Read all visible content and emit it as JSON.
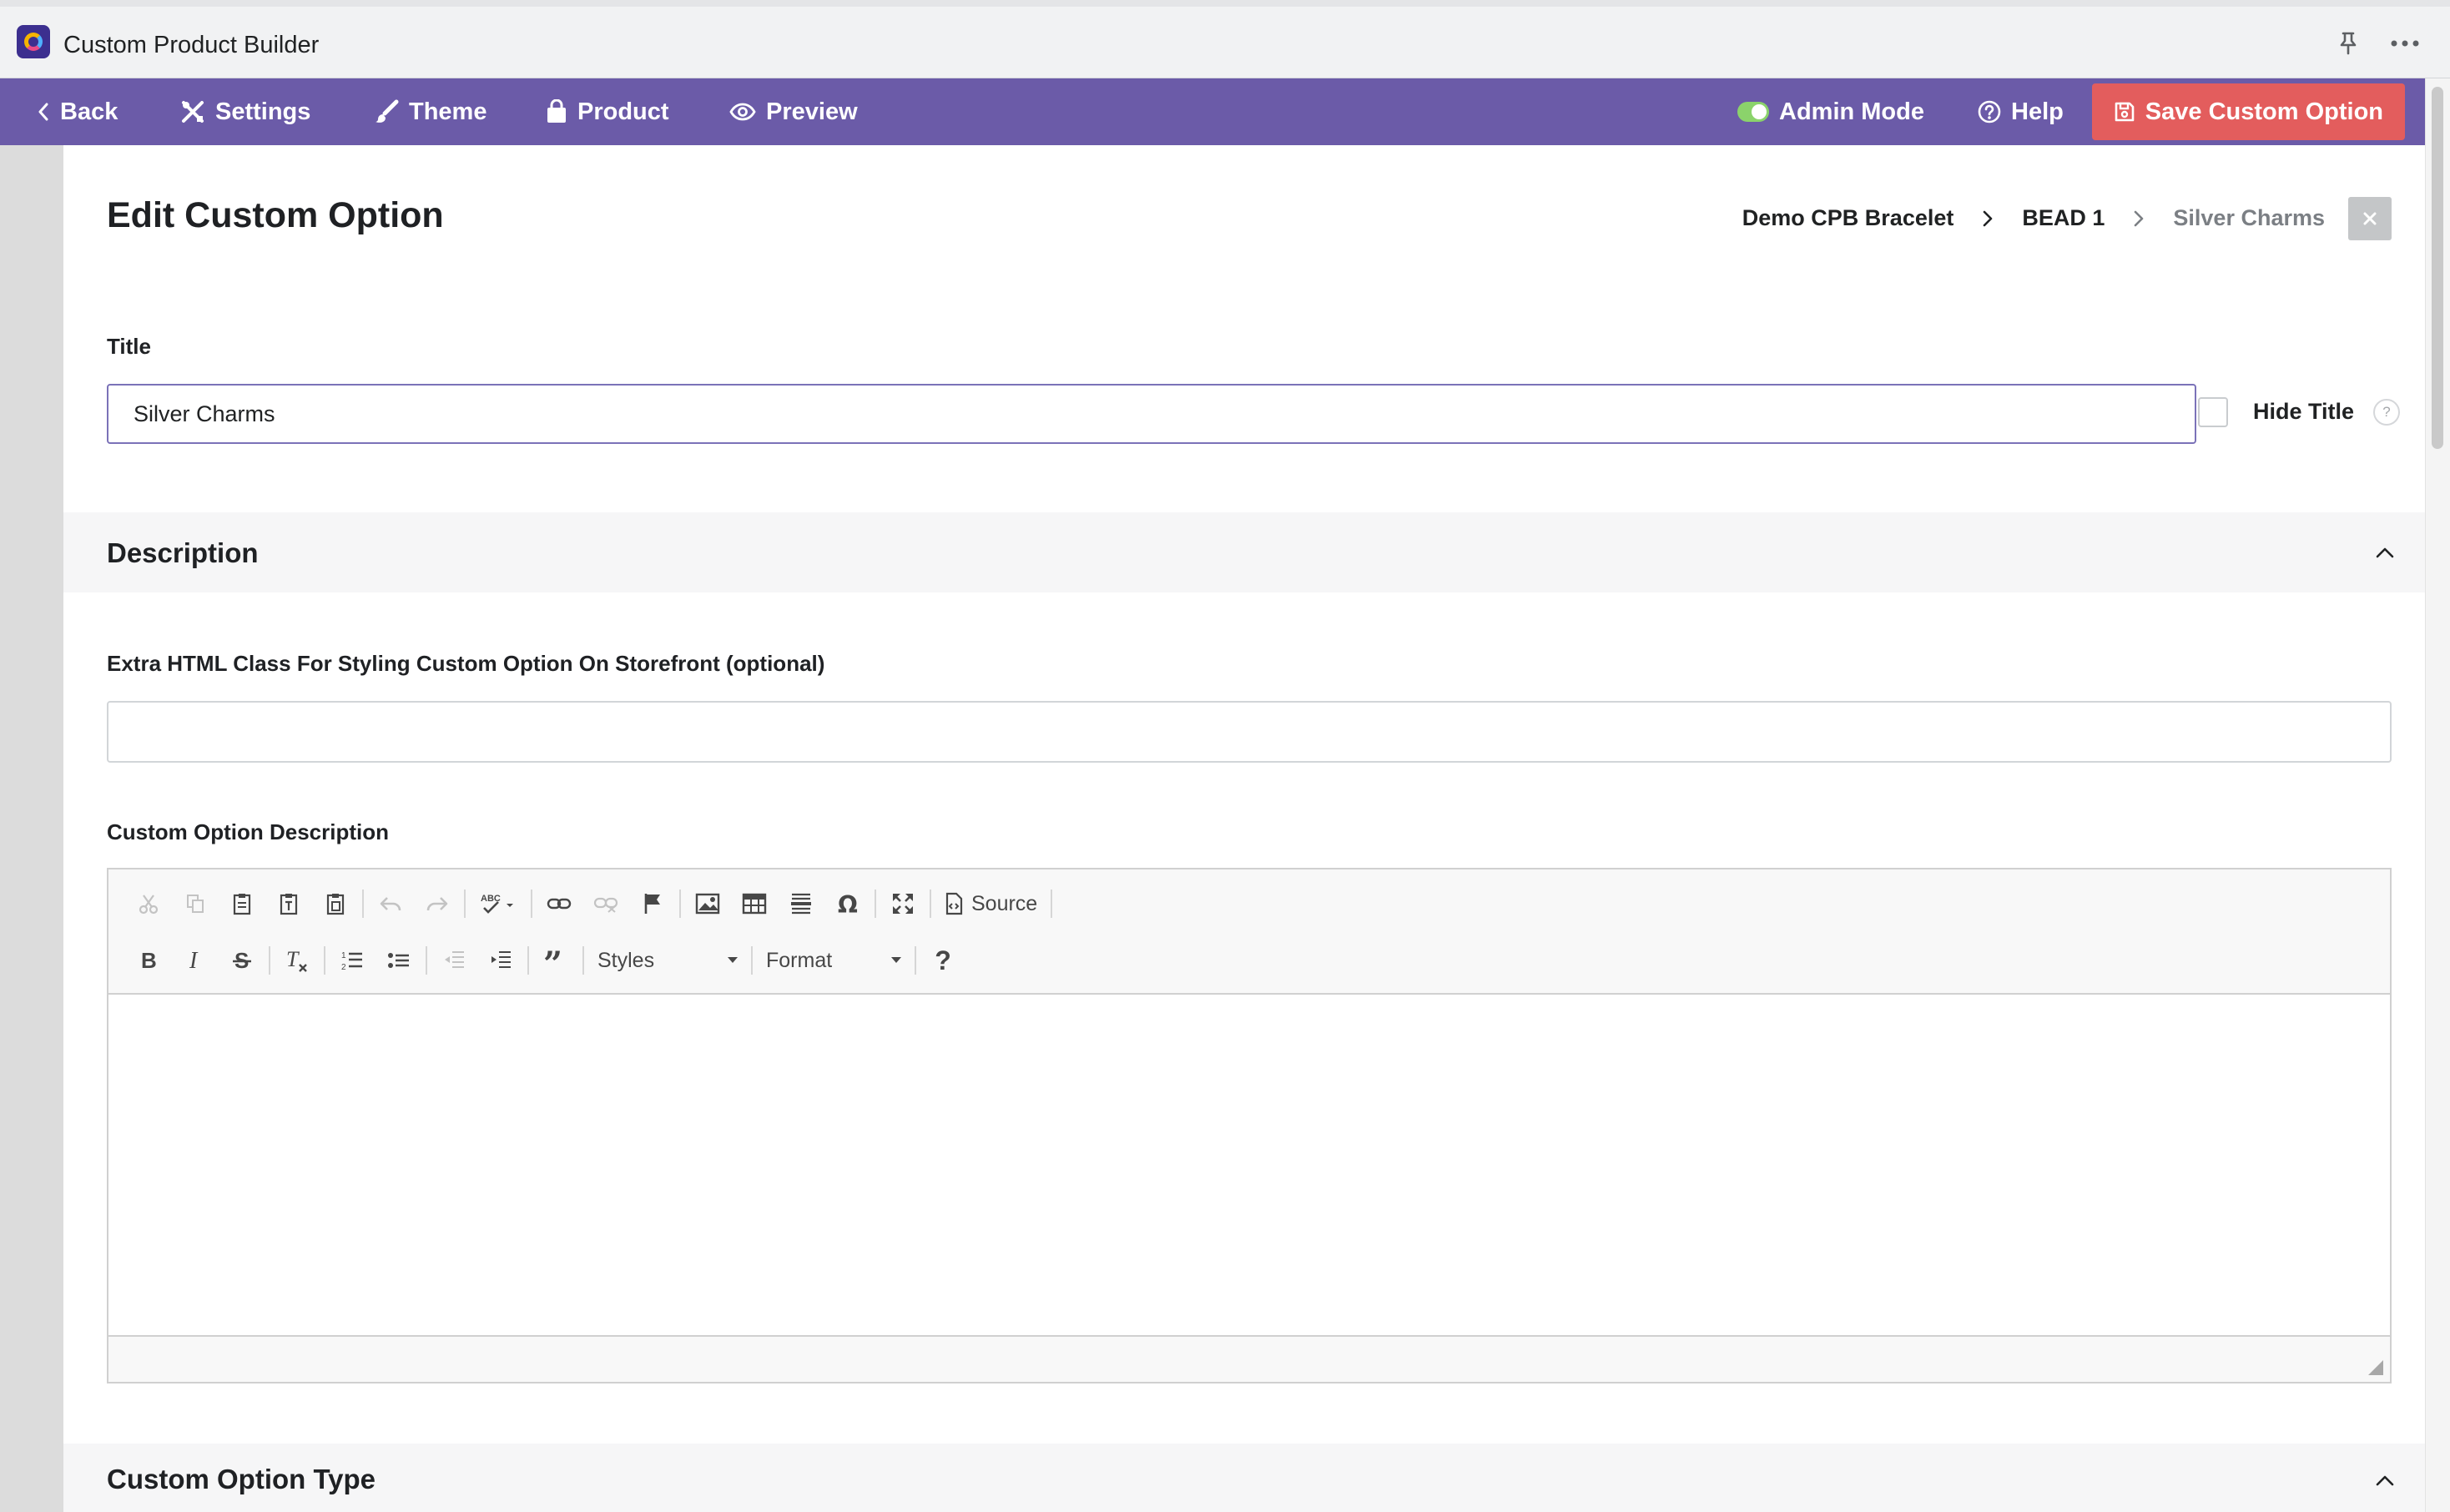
{
  "app": {
    "title": "Custom Product Builder"
  },
  "nav": {
    "back": "Back",
    "settings": "Settings",
    "theme": "Theme",
    "product": "Product",
    "preview": "Preview",
    "admin_mode": "Admin Mode",
    "help": "Help",
    "save": "Save Custom Option"
  },
  "page": {
    "title": "Edit Custom Option",
    "breadcrumb": [
      "Demo CPB Bracelet",
      "BEAD 1",
      "Silver Charms"
    ]
  },
  "title_field": {
    "label": "Title",
    "value": "Silver Charms",
    "hide_title_label": "Hide Title",
    "hide_title_checked": false,
    "help_glyph": "?"
  },
  "description_section": {
    "title": "Description",
    "class_label": "Extra HTML Class For Styling Custom Option On Storefront (optional)",
    "class_value": "",
    "editor_label": "Custom Option Description",
    "editor": {
      "styles_combo": "Styles",
      "format_combo": "Format",
      "source_label": "Source",
      "help_glyph": "?",
      "content": ""
    }
  },
  "type_section": {
    "title": "Custom Option Type"
  },
  "colors": {
    "nav_bg": "#6b5ba8",
    "save_btn": "#e35d5d",
    "admin_toggle": "#8bd36b",
    "input_focus_border": "#7b72b8"
  }
}
